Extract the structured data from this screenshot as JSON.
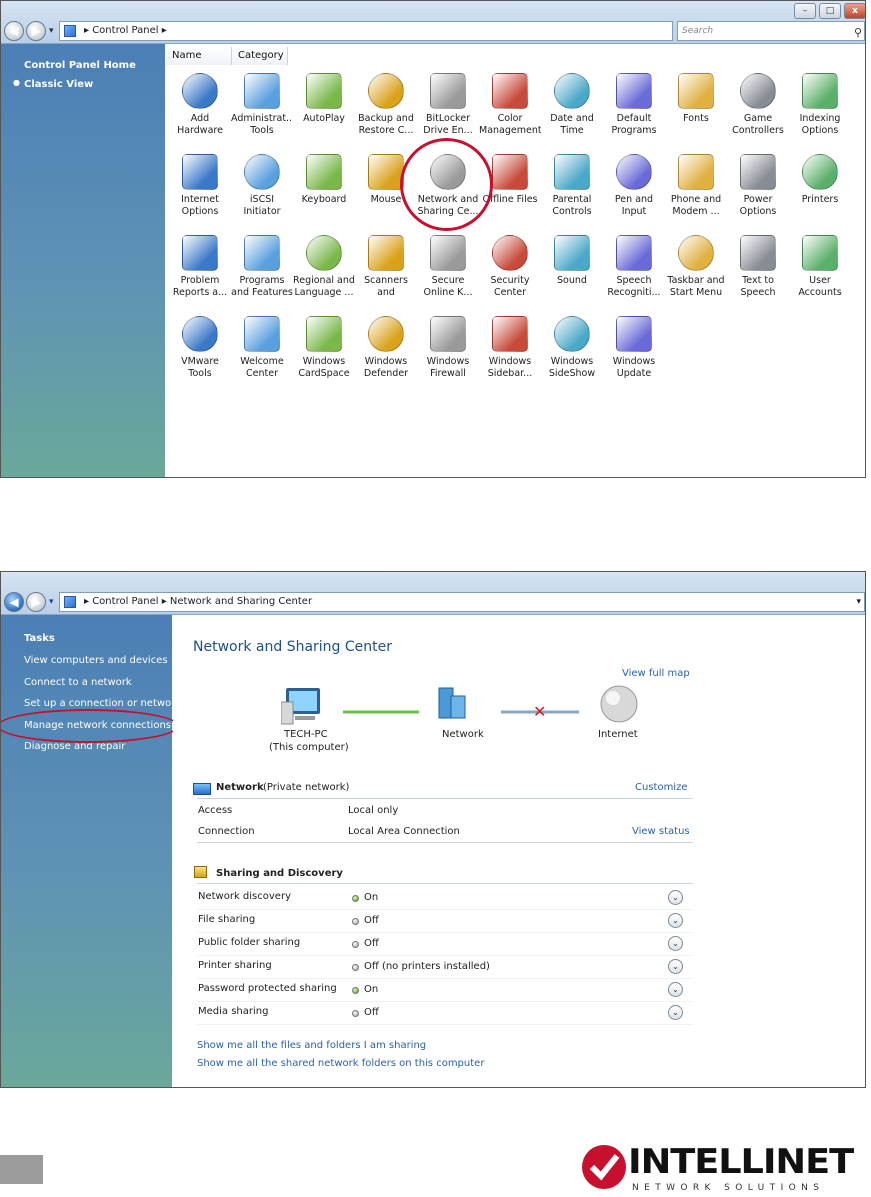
{
  "window1": {
    "breadcrumb": [
      "Control Panel"
    ],
    "search_placeholder": "Search",
    "window_controls": {
      "minimize": "–",
      "maximize": "□",
      "close": "x"
    },
    "sidebar": {
      "home": "Control Panel Home",
      "classic": "Classic View"
    },
    "columns": [
      "Name",
      "Category"
    ],
    "items": [
      {
        "label": "Add Hardware",
        "icon": "add-hardware-icon"
      },
      {
        "label": "Administrat... Tools",
        "icon": "administrative-tools-icon"
      },
      {
        "label": "AutoPlay",
        "icon": "autoplay-icon"
      },
      {
        "label": "Backup and Restore C...",
        "icon": "backup-restore-icon"
      },
      {
        "label": "BitLocker Drive En...",
        "icon": "bitlocker-icon"
      },
      {
        "label": "Color Management",
        "icon": "color-management-icon"
      },
      {
        "label": "Date and Time",
        "icon": "date-time-icon"
      },
      {
        "label": "Default Programs",
        "icon": "default-programs-icon"
      },
      {
        "label": "Fonts",
        "icon": "fonts-icon"
      },
      {
        "label": "Game Controllers",
        "icon": "game-controller-icon"
      },
      {
        "label": "Indexing Options",
        "icon": "indexing-options-icon"
      },
      {
        "label": "Internet Options",
        "icon": "internet-options-icon"
      },
      {
        "label": "iSCSI Initiator",
        "icon": "iscsi-initiator-icon"
      },
      {
        "label": "Keyboard",
        "icon": "keyboard-icon"
      },
      {
        "label": "Mouse",
        "icon": "mouse-icon"
      },
      {
        "label": "Network and Sharing Ce...",
        "icon": "network-sharing-icon"
      },
      {
        "label": "Offline Files",
        "icon": "offline-files-icon"
      },
      {
        "label": "Parental Controls",
        "icon": "parental-controls-icon"
      },
      {
        "label": "Pen and Input Devices",
        "icon": "pen-input-icon"
      },
      {
        "label": "Phone and Modem ...",
        "icon": "phone-modem-icon"
      },
      {
        "label": "Power Options",
        "icon": "power-options-icon"
      },
      {
        "label": "Printers",
        "icon": "printer-icon"
      },
      {
        "label": "Problem Reports a...",
        "icon": "problem-reports-icon"
      },
      {
        "label": "Programs and Features",
        "icon": "programs-features-icon"
      },
      {
        "label": "Regional and Language ...",
        "icon": "regional-language-icon"
      },
      {
        "label": "Scanners and Cameras",
        "icon": "scanner-camera-icon"
      },
      {
        "label": "Secure Online K...",
        "icon": "secure-online-key-icon"
      },
      {
        "label": "Security Center",
        "icon": "security-center-icon"
      },
      {
        "label": "Sound",
        "icon": "sound-icon"
      },
      {
        "label": "Speech Recogniti...",
        "icon": "speech-recognition-icon"
      },
      {
        "label": "Taskbar and Start Menu",
        "icon": "taskbar-start-menu-icon"
      },
      {
        "label": "Text to Speech",
        "icon": "text-to-speech-icon"
      },
      {
        "label": "User Accounts",
        "icon": "user-accounts-icon"
      },
      {
        "label": "VMware Tools",
        "icon": "vmware-tools-icon"
      },
      {
        "label": "Welcome Center",
        "icon": "welcome-center-icon"
      },
      {
        "label": "Windows CardSpace",
        "icon": "cardspace-icon"
      },
      {
        "label": "Windows Defender",
        "icon": "defender-icon"
      },
      {
        "label": "Windows Firewall",
        "icon": "firewall-icon"
      },
      {
        "label": "Windows Sidebar...",
        "icon": "sidebar-icon"
      },
      {
        "label": "Windows SideShow",
        "icon": "sideshow-icon"
      },
      {
        "label": "Windows Update",
        "icon": "windows-update-icon"
      }
    ]
  },
  "window2": {
    "breadcrumb": [
      "Control Panel",
      "Network and Sharing Center"
    ],
    "sidebar": {
      "tasks_heading": "Tasks",
      "items": [
        "View computers and devices",
        "Connect to a network",
        "Set up a connection or network",
        "Manage network connections",
        "Diagnose and repair"
      ]
    },
    "title": "Network and Sharing Center",
    "view_full_map": "View full map",
    "map": {
      "computer": "TECH-PC",
      "computer_sub": "(This computer)",
      "network": "Network",
      "internet": "Internet"
    },
    "network_section": {
      "name": "Network",
      "type": "(Private network)",
      "customize": "Customize",
      "rows": [
        {
          "label": "Access",
          "value": "Local only"
        },
        {
          "label": "Connection",
          "value": "Local Area Connection",
          "link": "View status"
        }
      ]
    },
    "sharing_section": {
      "heading": "Sharing and Discovery",
      "rows": [
        {
          "label": "Network discovery",
          "status": "On",
          "on": true
        },
        {
          "label": "File sharing",
          "status": "Off",
          "on": false
        },
        {
          "label": "Public folder sharing",
          "status": "Off",
          "on": false
        },
        {
          "label": "Printer sharing",
          "status": "Off (no printers installed)",
          "on": false
        },
        {
          "label": "Password protected sharing",
          "status": "On",
          "on": true
        },
        {
          "label": "Media sharing",
          "status": "Off",
          "on": false
        }
      ]
    },
    "bottom_links": [
      "Show me all the files and folders I am sharing",
      "Show me all the shared network folders on this computer"
    ]
  },
  "footer": {
    "brand": "INTELLINET",
    "tagline": "NETWORK SOLUTIONS",
    "brand_color": "#c8102e"
  }
}
